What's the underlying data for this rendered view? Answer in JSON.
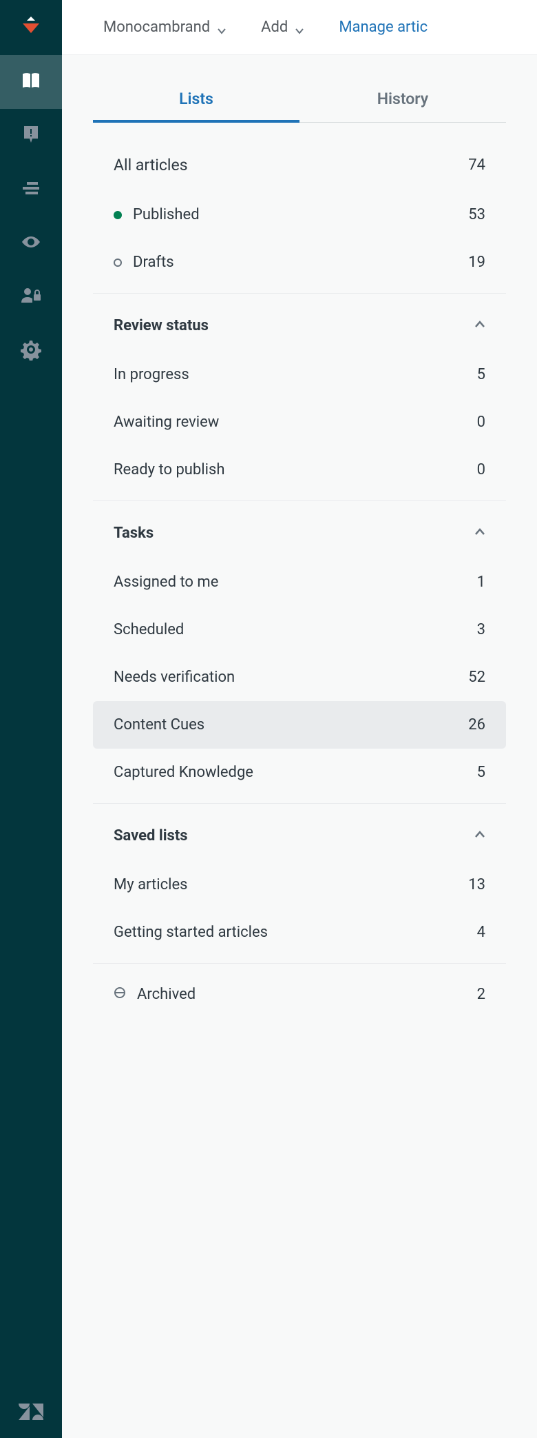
{
  "topbar": {
    "brand": "Monocambrand",
    "add": "Add",
    "manage": "Manage artic"
  },
  "tabs": {
    "lists": "Lists",
    "history": "History"
  },
  "topSection": {
    "all": {
      "label": "All articles",
      "count": "74"
    },
    "published": {
      "label": "Published",
      "count": "53"
    },
    "drafts": {
      "label": "Drafts",
      "count": "19"
    }
  },
  "reviewStatus": {
    "header": "Review status",
    "items": [
      {
        "label": "In progress",
        "count": "5"
      },
      {
        "label": "Awaiting review",
        "count": "0"
      },
      {
        "label": "Ready to publish",
        "count": "0"
      }
    ]
  },
  "tasks": {
    "header": "Tasks",
    "items": [
      {
        "label": "Assigned to me",
        "count": "1"
      },
      {
        "label": "Scheduled",
        "count": "3"
      },
      {
        "label": "Needs verification",
        "count": "52"
      },
      {
        "label": "Content Cues",
        "count": "26"
      },
      {
        "label": "Captured Knowledge",
        "count": "5"
      }
    ]
  },
  "savedLists": {
    "header": "Saved lists",
    "items": [
      {
        "label": "My articles",
        "count": "13"
      },
      {
        "label": "Getting started articles",
        "count": "4"
      }
    ]
  },
  "archived": {
    "label": "Archived",
    "count": "2"
  }
}
